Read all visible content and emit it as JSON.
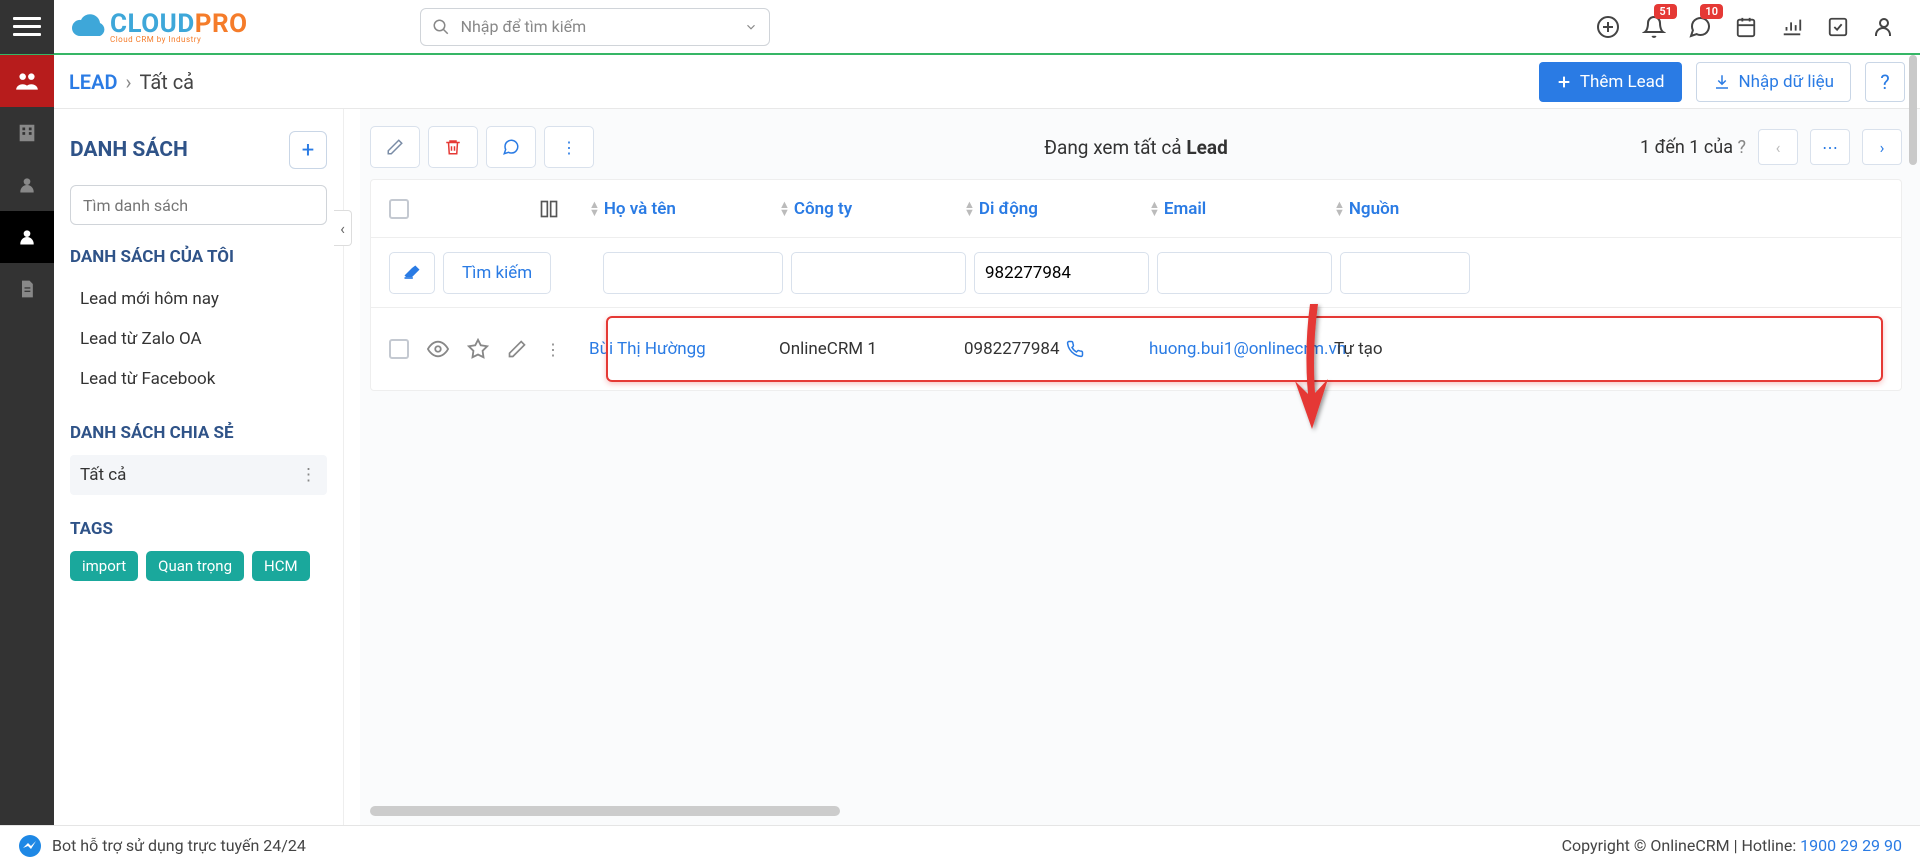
{
  "topbar": {
    "search_placeholder": "Nhập để tìm kiếm",
    "badges": {
      "bell": "51",
      "chat": "10"
    }
  },
  "subheader": {
    "module": "LEAD",
    "crumb": "Tất cả",
    "add_lead": "Thêm Lead",
    "import": "Nhập dữ liệu"
  },
  "leftpanel": {
    "title": "DANH SÁCH",
    "search_placeholder": "Tìm danh sách",
    "my_lists_title": "DANH SÁCH CỦA TÔI",
    "my_lists": [
      "Lead mới hôm nay",
      "Lead từ Zalo OA",
      "Lead từ Facebook"
    ],
    "shared_title": "DANH SÁCH CHIA SẺ",
    "shared_active": "Tất cả",
    "tags_title": "TAGS",
    "tags": [
      "import",
      "Quan trọng",
      "HCM"
    ]
  },
  "toolbar": {
    "viewing_prefix": "Đang xem tất cả ",
    "viewing_bold": "Lead",
    "pager_text": "1 đến 1 của ",
    "pager_q": "?"
  },
  "columns": {
    "name": "Họ và tên",
    "company": "Công ty",
    "phone": "Di động",
    "email": "Email",
    "source": "Nguồn"
  },
  "filters": {
    "search_btn": "Tìm kiếm",
    "phone_value": "982277984"
  },
  "row": {
    "name": "Bùi Thị Hườngg",
    "company": "OnlineCRM 1",
    "phone": "0982277984",
    "email": "huong.bui1@onlinecrm.vn",
    "source": "Tự tạo"
  },
  "footer": {
    "bot": "Bot hỗ trợ sử dụng trực tuyến 24/24",
    "copyright": "Copyright © OnlineCRM",
    "hotline_label": "Hotline: ",
    "hotline": "1900 29 29 90"
  }
}
